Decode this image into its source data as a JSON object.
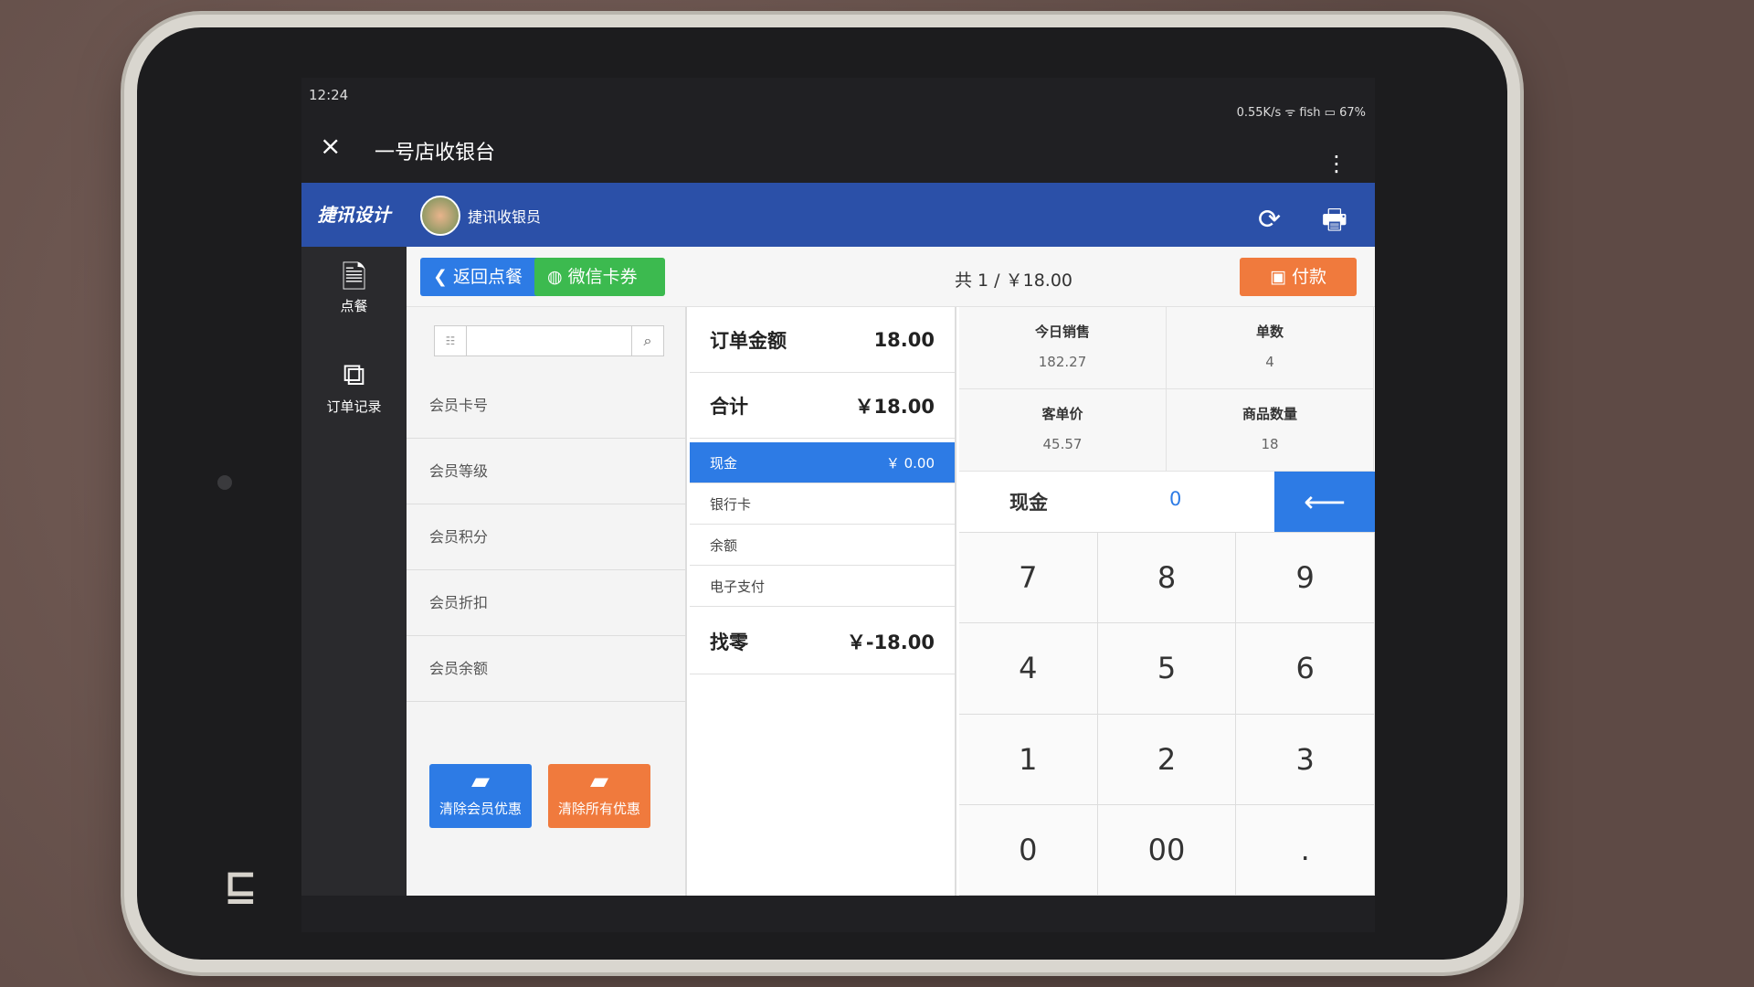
{
  "status": {
    "time": "12:24",
    "right": "0.55K/s  ᯤ  fish  ▭ 67%"
  },
  "window": {
    "close_icon": "×",
    "title": "一号店收银台",
    "more_icon": "⋮"
  },
  "header": {
    "logo": "捷讯设计",
    "cashier_name": "捷讯收银员",
    "refresh_icon": "⟳",
    "print_icon": "🖶"
  },
  "sidebar": {
    "items": [
      {
        "icon": "🗎",
        "label": "点餐"
      },
      {
        "icon": "⧉",
        "label": "订单记录"
      }
    ]
  },
  "actions": {
    "back_label": "❮ 返回点餐",
    "wechat_label": "◍ 微信卡券",
    "summary": "共 1 / ￥18.00",
    "pay_label": "▣ 付款"
  },
  "member": {
    "search_prefix": "☷",
    "search_placeholder": "",
    "search_icon": "⌕",
    "rows": [
      "会员卡号",
      "会员等级",
      "会员积分",
      "会员折扣",
      "会员余额"
    ],
    "clear_member": "清除会员优惠",
    "clear_all": "清除所有优惠",
    "clear_icon": "▰"
  },
  "payment": {
    "order_amount_label": "订单金额",
    "order_amount": "18.00",
    "total_label": "合计",
    "total": "￥18.00",
    "methods": [
      {
        "label": "现金",
        "value": "￥ 0.00"
      },
      {
        "label": "银行卡",
        "value": ""
      },
      {
        "label": "余额",
        "value": ""
      },
      {
        "label": "电子支付",
        "value": ""
      }
    ],
    "change_label": "找零",
    "change": "￥-18.00"
  },
  "stats": [
    {
      "label": "今日销售",
      "value": "182.27"
    },
    {
      "label": "单数",
      "value": "4"
    },
    {
      "label": "客单价",
      "value": "45.57"
    },
    {
      "label": "商品数量",
      "value": "18"
    }
  ],
  "cash_input": {
    "label": "现金",
    "value": "0",
    "backspace_icon": "⟵"
  },
  "keypad": [
    "7",
    "8",
    "9",
    "4",
    "5",
    "6",
    "1",
    "2",
    "3",
    "0",
    "00",
    "."
  ],
  "colors": {
    "primary": "#2d7be5",
    "header": "#2b50a8",
    "green": "#3cba4f",
    "orange": "#f07a3d"
  }
}
